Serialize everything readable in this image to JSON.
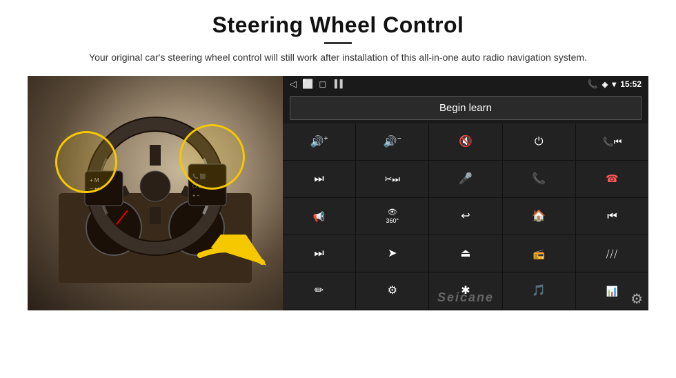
{
  "header": {
    "title": "Steering Wheel Control",
    "subtitle": "Your original car's steering wheel control will still work after installation of this all-in-one auto radio navigation system."
  },
  "status_bar": {
    "back_icon": "◁",
    "home_icon": "⬜",
    "recent_icon": "◻",
    "phone_icon": "📞",
    "location_icon": "◈",
    "wifi_icon": "▾",
    "time": "15:52"
  },
  "begin_learn_label": "Begin learn",
  "controls": [
    {
      "icon": "🔊+",
      "label": "vol-up"
    },
    {
      "icon": "🔊−",
      "label": "vol-down"
    },
    {
      "icon": "🔇",
      "label": "mute"
    },
    {
      "icon": "⏻",
      "label": "power"
    },
    {
      "icon": "📞⏮",
      "label": "call-prev"
    },
    {
      "icon": "⏭",
      "label": "next-track"
    },
    {
      "icon": "✂⏭",
      "label": "ff"
    },
    {
      "icon": "🎤",
      "label": "mic"
    },
    {
      "icon": "📞",
      "label": "call"
    },
    {
      "icon": "📞↩",
      "label": "hang-up"
    },
    {
      "icon": "🔊",
      "label": "speaker"
    },
    {
      "icon": "360",
      "label": "360-cam"
    },
    {
      "icon": "↩",
      "label": "back"
    },
    {
      "icon": "🏠",
      "label": "home"
    },
    {
      "icon": "⏮⏮",
      "label": "prev-track"
    },
    {
      "icon": "⏭⏭",
      "label": "fast-forward"
    },
    {
      "icon": "➤",
      "label": "nav"
    },
    {
      "icon": "⏏",
      "label": "eject"
    },
    {
      "icon": "📻",
      "label": "radio"
    },
    {
      "icon": "|||",
      "label": "settings-sliders"
    },
    {
      "icon": "✏",
      "label": "edit"
    },
    {
      "icon": "⚙",
      "label": "settings2"
    },
    {
      "icon": "✱",
      "label": "bluetooth"
    },
    {
      "icon": "🎵",
      "label": "music"
    },
    {
      "icon": "📊",
      "label": "equalizer"
    }
  ],
  "watermark": "Seicane",
  "gear_icon": "⚙"
}
